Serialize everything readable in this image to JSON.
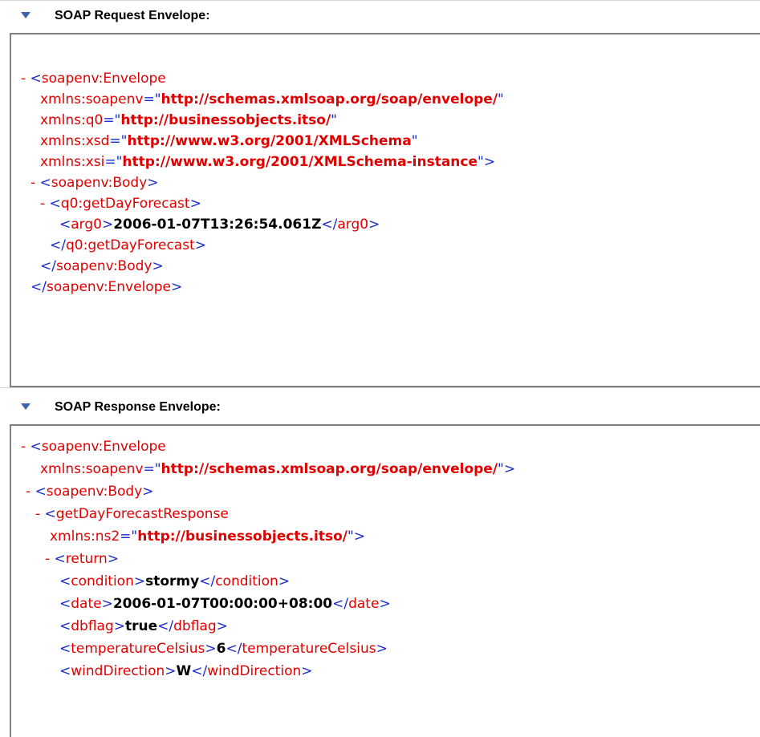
{
  "request": {
    "title": "SOAP Request Envelope:",
    "lines": [
      {
        "indent": 0,
        "tog": "-",
        "parts": [
          [
            "b",
            "<"
          ],
          [
            "r",
            "soapenv:Envelope"
          ]
        ]
      },
      {
        "indent": 2,
        "parts": [
          [
            "an",
            "xmlns:soapenv"
          ],
          [
            "b",
            "=\""
          ],
          [
            "av",
            "http://schemas.xmlsoap.org/soap/envelope/"
          ],
          [
            "b",
            "\""
          ]
        ]
      },
      {
        "indent": 2,
        "parts": [
          [
            "an",
            "xmlns:q0"
          ],
          [
            "b",
            "=\""
          ],
          [
            "av",
            "http://businessobjects.itso/"
          ],
          [
            "b",
            "\""
          ]
        ]
      },
      {
        "indent": 2,
        "parts": [
          [
            "an",
            "xmlns:xsd"
          ],
          [
            "b",
            "=\""
          ],
          [
            "av",
            "http://www.w3.org/2001/XMLSchema"
          ],
          [
            "b",
            "\""
          ]
        ]
      },
      {
        "indent": 2,
        "parts": [
          [
            "an",
            "xmlns:xsi"
          ],
          [
            "b",
            "=\""
          ],
          [
            "av",
            "http://www.w3.org/2001/XMLSchema-instance"
          ],
          [
            "b",
            "\">"
          ]
        ]
      },
      {
        "indent": 1,
        "tog": "-",
        "parts": [
          [
            "b",
            "<"
          ],
          [
            "r",
            "soapenv:Body"
          ],
          [
            "b",
            ">"
          ]
        ]
      },
      {
        "indent": 2,
        "tog": "-",
        "parts": [
          [
            "b",
            "<"
          ],
          [
            "r",
            "q0:getDayForecast"
          ],
          [
            "b",
            ">"
          ]
        ]
      },
      {
        "indent": 4,
        "parts": [
          [
            "b",
            "<"
          ],
          [
            "r",
            "arg0"
          ],
          [
            "b",
            ">"
          ],
          [
            "tx",
            "2006-01-07T13:26:54.061Z"
          ],
          [
            "b",
            "</"
          ],
          [
            "r",
            "arg0"
          ],
          [
            "b",
            ">"
          ]
        ]
      },
      {
        "indent": 3,
        "parts": [
          [
            "b",
            "</"
          ],
          [
            "r",
            "q0:getDayForecast"
          ],
          [
            "b",
            ">"
          ]
        ]
      },
      {
        "indent": 2,
        "parts": [
          [
            "b",
            "</"
          ],
          [
            "r",
            "soapenv:Body"
          ],
          [
            "b",
            ">"
          ]
        ]
      },
      {
        "indent": 1,
        "parts": [
          [
            "b",
            "</"
          ],
          [
            "r",
            "soapenv:Envelope"
          ],
          [
            "b",
            ">"
          ]
        ]
      }
    ]
  },
  "response": {
    "title": "SOAP Response Envelope:",
    "lines": [
      {
        "indent": 0,
        "tog": "-",
        "parts": [
          [
            "b",
            "<"
          ],
          [
            "r",
            "soapenv:Envelope"
          ]
        ]
      },
      {
        "indent": 2,
        "parts": [
          [
            "an",
            "xmlns:soapenv"
          ],
          [
            "b",
            "=\""
          ],
          [
            "av",
            "http://schemas.xmlsoap.org/soap/envelope/"
          ],
          [
            "b",
            "\">"
          ]
        ]
      },
      {
        "indent": 0.5,
        "tog": "-",
        "parts": [
          [
            "b",
            "<"
          ],
          [
            "r",
            "soapenv:Body"
          ],
          [
            "b",
            ">"
          ]
        ]
      },
      {
        "indent": 1.5,
        "tog": "-",
        "parts": [
          [
            "b",
            "<"
          ],
          [
            "r",
            "getDayForecastResponse"
          ]
        ]
      },
      {
        "indent": 3,
        "parts": [
          [
            "an",
            "xmlns:ns2"
          ],
          [
            "b",
            "=\""
          ],
          [
            "av",
            "http://businessobjects.itso/"
          ],
          [
            "b",
            "\">"
          ]
        ]
      },
      {
        "indent": 2.5,
        "tog": "-",
        "parts": [
          [
            "b",
            "<"
          ],
          [
            "r",
            "return"
          ],
          [
            "b",
            ">"
          ]
        ]
      },
      {
        "indent": 4,
        "parts": [
          [
            "b",
            "<"
          ],
          [
            "r",
            "condition"
          ],
          [
            "b",
            ">"
          ],
          [
            "tx",
            "stormy"
          ],
          [
            "b",
            "</"
          ],
          [
            "r",
            "condition"
          ],
          [
            "b",
            ">"
          ]
        ]
      },
      {
        "indent": 4,
        "parts": [
          [
            "b",
            "<"
          ],
          [
            "r",
            "date"
          ],
          [
            "b",
            ">"
          ],
          [
            "tx",
            "2006-01-07T00:00:00+08:00"
          ],
          [
            "b",
            "</"
          ],
          [
            "r",
            "date"
          ],
          [
            "b",
            ">"
          ]
        ]
      },
      {
        "indent": 4,
        "parts": [
          [
            "b",
            "<"
          ],
          [
            "r",
            "dbflag"
          ],
          [
            "b",
            ">"
          ],
          [
            "tx",
            "true"
          ],
          [
            "b",
            "</"
          ],
          [
            "r",
            "dbflag"
          ],
          [
            "b",
            ">"
          ]
        ]
      },
      {
        "indent": 4,
        "parts": [
          [
            "b",
            "<"
          ],
          [
            "r",
            "temperatureCelsius"
          ],
          [
            "b",
            ">"
          ],
          [
            "tx",
            "6"
          ],
          [
            "b",
            "</"
          ],
          [
            "r",
            "temperatureCelsius"
          ],
          [
            "b",
            ">"
          ]
        ]
      },
      {
        "indent": 4,
        "parts": [
          [
            "b",
            "<"
          ],
          [
            "r",
            "windDirection"
          ],
          [
            "b",
            ">"
          ],
          [
            "tx",
            "W"
          ],
          [
            "b",
            "</"
          ],
          [
            "r",
            "windDirection"
          ],
          [
            "b",
            ">"
          ]
        ]
      }
    ]
  }
}
